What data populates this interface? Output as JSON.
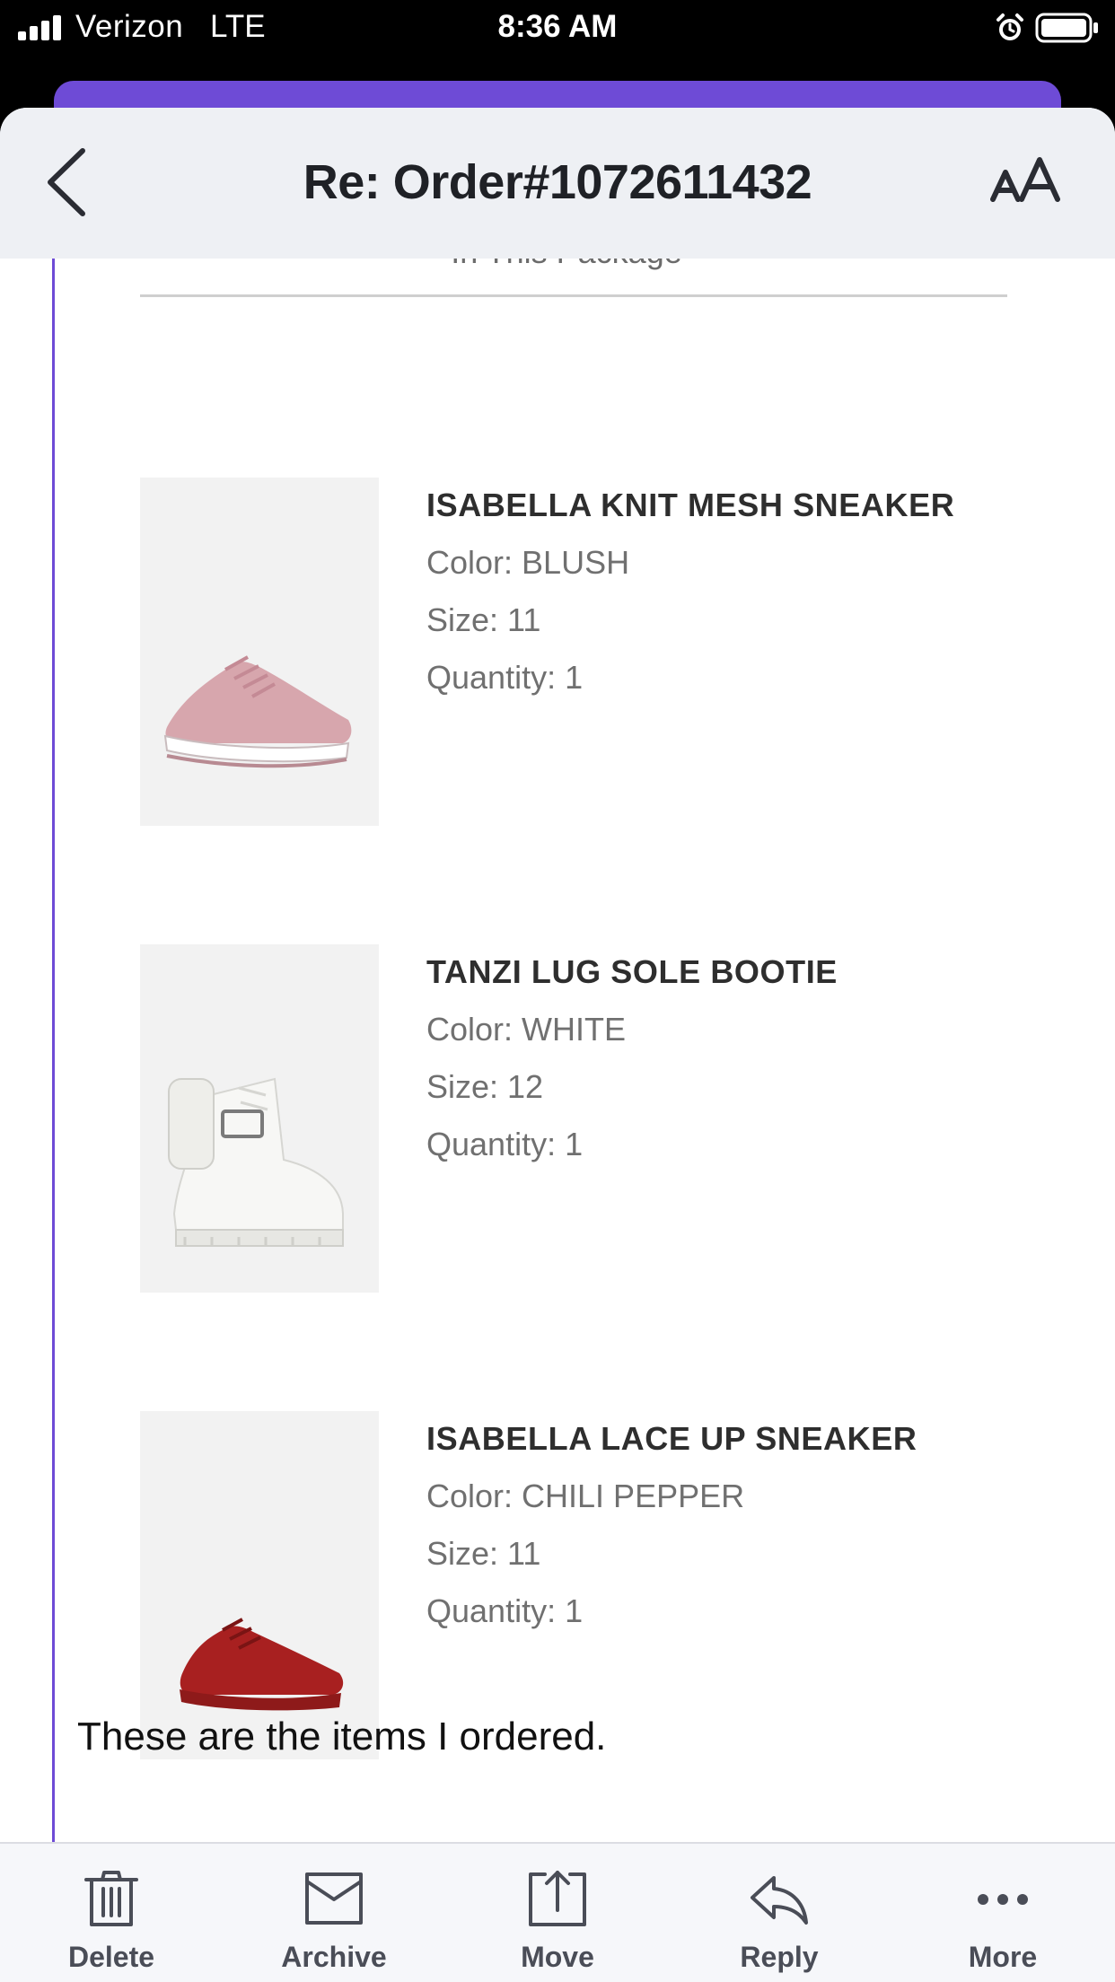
{
  "status_bar": {
    "carrier": "Verizon",
    "network": "LTE",
    "time": "8:36 AM"
  },
  "header": {
    "title": "Re: Order#1072611432",
    "back_icon": "chevron-left-icon",
    "font_size_icon": "text-size-icon"
  },
  "message": {
    "cut_heading": "In This Package",
    "items": [
      {
        "name": "ISABELLA KNIT MESH SNEAKER",
        "color": "Color: BLUSH",
        "size": "Size: 11",
        "quantity": "Quantity: 1",
        "image_color": "#d9a9b0"
      },
      {
        "name": "TANZI LUG SOLE BOOTIE",
        "color": "Color: WHITE",
        "size": "Size: 12",
        "quantity": "Quantity: 1",
        "image_color": "#f4f4f2"
      },
      {
        "name": "ISABELLA LACE UP SNEAKER",
        "color": "Color: CHILI PEPPER",
        "size": "Size: 11",
        "quantity": "Quantity: 1",
        "image_color": "#a82020"
      }
    ],
    "note": "These are the items I ordered."
  },
  "toolbar": {
    "delete": "Delete",
    "archive": "Archive",
    "move": "Move",
    "reply": "Reply",
    "more": "More"
  },
  "colors": {
    "accent": "#6e4bd6",
    "header_bg": "#eef0f4",
    "toolbar_bg": "#f6f7fa"
  }
}
